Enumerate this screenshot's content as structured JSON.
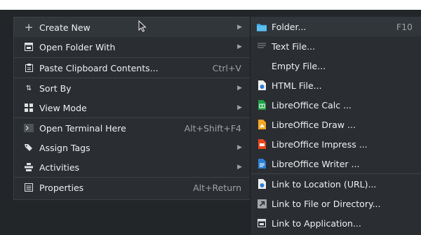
{
  "main_menu": {
    "create_new": {
      "label": "Create New"
    },
    "open_folder_with": {
      "label": "Open Folder With"
    },
    "paste_clipboard": {
      "label": "Paste Clipboard Contents...",
      "shortcut": "Ctrl+V"
    },
    "sort_by": {
      "label": "Sort By"
    },
    "view_mode": {
      "label": "View Mode"
    },
    "open_terminal": {
      "label": "Open Terminal Here",
      "shortcut": "Alt+Shift+F4"
    },
    "assign_tags": {
      "label": "Assign Tags"
    },
    "activities": {
      "label": "Activities"
    },
    "properties": {
      "label": "Properties",
      "shortcut": "Alt+Return"
    }
  },
  "sub_menu": {
    "folder": {
      "label": "Folder...",
      "shortcut": "F10"
    },
    "text_file": {
      "label": "Text File..."
    },
    "empty_file": {
      "label": "Empty File..."
    },
    "html_file": {
      "label": "HTML File..."
    },
    "calc": {
      "label": "LibreOffice Calc ..."
    },
    "draw": {
      "label": "LibreOffice Draw ..."
    },
    "impress": {
      "label": "LibreOffice Impress ..."
    },
    "writer": {
      "label": "LibreOffice Writer ..."
    },
    "link_url": {
      "label": "Link to Location (URL)..."
    },
    "link_file": {
      "label": "Link to File or Directory..."
    },
    "link_app": {
      "label": "Link to Application..."
    }
  },
  "colors": {
    "menu_bg": "#2a2e32",
    "highlight": "#31363b",
    "folder_icon": "#3daee9",
    "calc": "#1e9e43",
    "draw": "#f5a623",
    "impress": "#e8471e",
    "writer": "#2a7fd5"
  }
}
